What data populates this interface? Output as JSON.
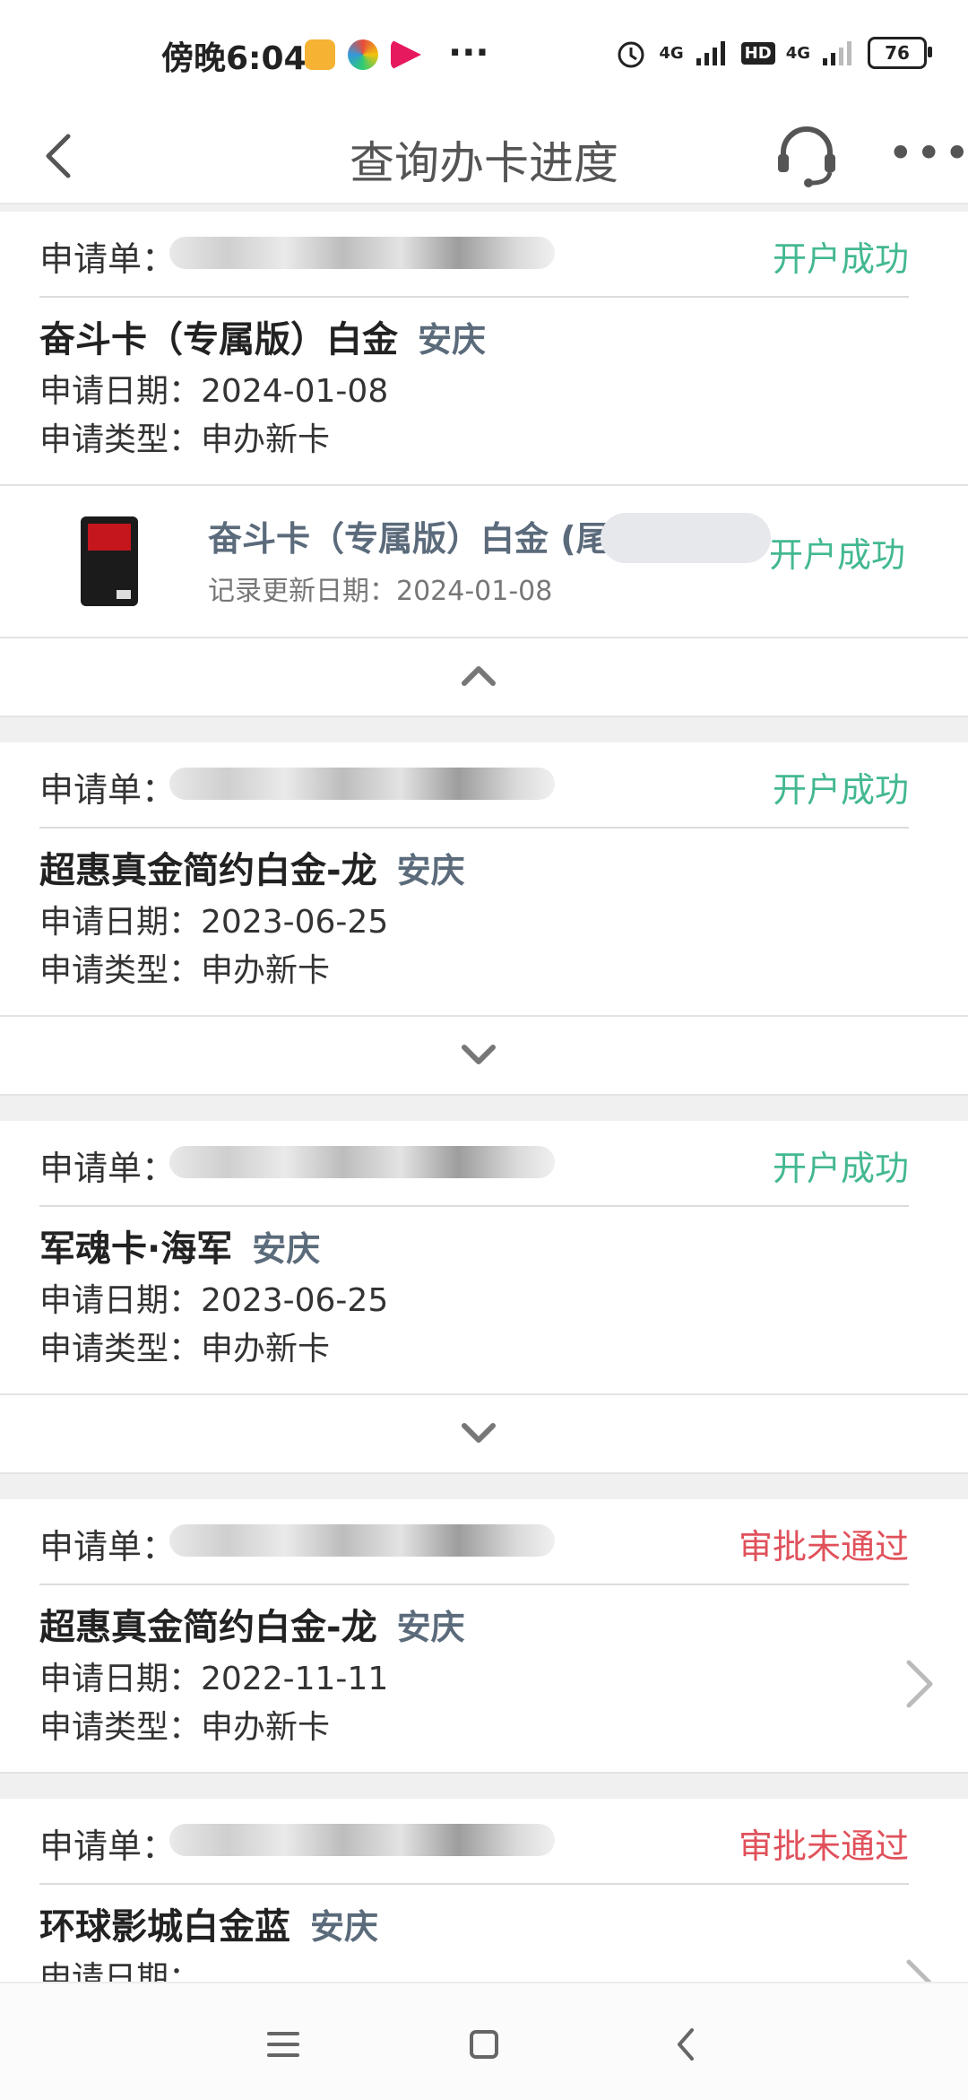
{
  "status_bar": {
    "time": "傍晚6:04",
    "more": "···",
    "network1": "4G",
    "hd": "HD",
    "network2": "4G",
    "battery": "76"
  },
  "nav": {
    "title": "查询办卡进度"
  },
  "labels": {
    "app_no": "申请单：",
    "date_prefix": "申请日期：",
    "type_prefix": "申请类型："
  },
  "applications": [
    {
      "status": "开户成功",
      "status_type": "ok",
      "card_name": "奋斗卡（专属版）白金",
      "city": "安庆",
      "date": "2024-01-08",
      "type": "申办新卡",
      "expanded": true,
      "detail": {
        "name": "奋斗卡（专属版）白金 (尾",
        "updated": "记录更新日期：2024-01-08",
        "status": "开户成功"
      }
    },
    {
      "status": "开户成功",
      "status_type": "ok",
      "card_name": "超惠真金简约白金-龙",
      "city": "安庆",
      "date": "2023-06-25",
      "type": "申办新卡",
      "expanded": false
    },
    {
      "status": "开户成功",
      "status_type": "ok",
      "card_name": "军魂卡·海军",
      "city": "安庆",
      "date": "2023-06-25",
      "type": "申办新卡",
      "expanded": false
    },
    {
      "status": "审批未通过",
      "status_type": "fail",
      "card_name": "超惠真金简约白金-龙",
      "city": "安庆",
      "date": "2022-11-11",
      "type": "申办新卡",
      "expanded": false
    },
    {
      "status": "审批未通过",
      "status_type": "fail",
      "card_name": "环球影城白金蓝",
      "city": "安庆",
      "date": "",
      "type": "",
      "expanded": false
    }
  ],
  "colors": {
    "ok": "#43b891",
    "fail": "#e0515b",
    "city": "#5b6b7b"
  }
}
